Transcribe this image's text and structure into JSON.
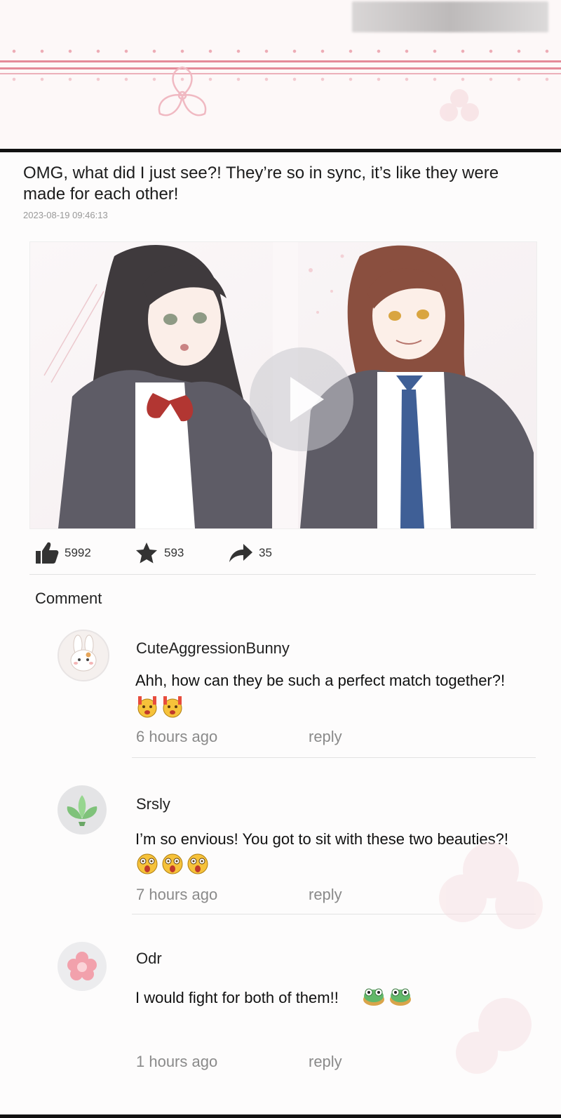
{
  "post": {
    "text": "OMG, what did I just see?! They’re so in sync, it’s like they were made for each other!",
    "timestamp": "2023-08-19 09:46:13",
    "media_type": "video"
  },
  "stats": {
    "likes": "5992",
    "favorites": "593",
    "shares": "35"
  },
  "icons": {
    "like": "thumbs-up-icon",
    "favorite": "star-icon",
    "share": "share-arrow-icon",
    "play": "play-icon"
  },
  "comments_section": {
    "title": "Comment",
    "items": [
      {
        "username": "CuteAggressionBunny",
        "text": "Ahh, how can they be such a perfect match together?!",
        "emoji": "cheering-emoji",
        "emoji_count": 2,
        "time": "6 hours ago",
        "reply_label": "reply",
        "avatar": "bunny-avatar"
      },
      {
        "username": "Srsly",
        "text": "I’m so envious! You got to sit with these two beauties?!",
        "emoji": "shocked-emoji",
        "emoji_count": 3,
        "time": "7 hours ago",
        "reply_label": "reply",
        "avatar": "leaf-avatar"
      },
      {
        "username": "Odr",
        "text": "I would fight for both of them!!",
        "emoji": "frog-emoji",
        "emoji_count": 2,
        "time": "1 hours ago",
        "reply_label": "reply",
        "avatar": "flower-avatar"
      }
    ]
  },
  "colors": {
    "accent_pink": "#e48a98",
    "text_dark": "#1c1c1c",
    "text_muted": "#8a8a8a"
  }
}
